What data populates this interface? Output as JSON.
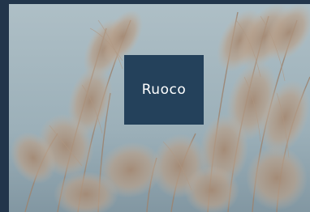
{
  "brand": {
    "logo_text": "Ruoco"
  },
  "colors": {
    "page_background": "#22354b",
    "logo_background": "#24415b",
    "logo_text": "#ffffff",
    "sky": "#9fb2bb",
    "grass": "#b39a84"
  },
  "photo": {
    "subject_icon": "reed-grass-photo"
  }
}
